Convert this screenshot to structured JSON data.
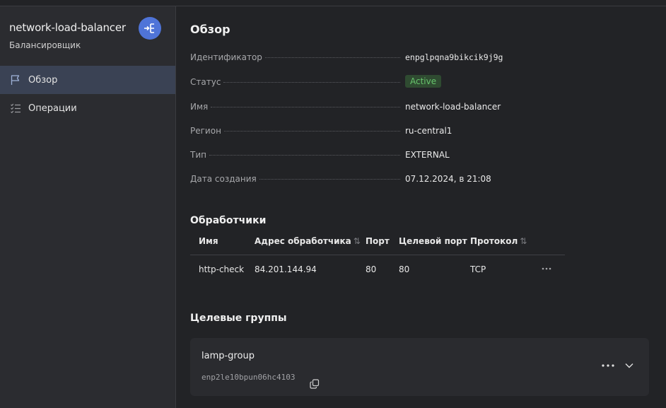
{
  "sidebar": {
    "title": "network-load-balancer",
    "subtitle": "Балансировщик",
    "service_icon": "load-balancer-icon",
    "items": [
      {
        "label": "Обзор",
        "icon": "flag-icon",
        "active": true
      },
      {
        "label": "Операции",
        "icon": "list-icon",
        "active": false
      }
    ]
  },
  "main": {
    "title": "Обзор",
    "properties": [
      {
        "label": "Идентификатор",
        "value": "enpglpqna9bikcik9j9g"
      },
      {
        "label": "Статус",
        "value": "Active"
      },
      {
        "label": "Имя",
        "value": "network-load-balancer"
      },
      {
        "label": "Регион",
        "value": "ru-central1"
      },
      {
        "label": "Тип",
        "value": "EXTERNAL"
      },
      {
        "label": "Дата создания",
        "value": "07.12.2024, в 21:08"
      }
    ],
    "status_colors": {
      "bg": "#2f4b31",
      "text": "#67c46c"
    },
    "listeners": {
      "title": "Обработчики",
      "columns": [
        "Имя",
        "Адрес обработчика",
        "Порт",
        "Целевой порт",
        "Протокол"
      ],
      "sort_icon": "sort-icon",
      "rows": [
        {
          "name": "http-check",
          "address": "84.201.144.94",
          "port": "80",
          "target_port": "80",
          "protocol": "TCP"
        }
      ]
    },
    "target_groups": {
      "title": "Целевые группы",
      "items": [
        {
          "name": "lamp-group",
          "id": "enp2le10bpun06hc4103"
        }
      ]
    }
  },
  "colors": {
    "accent": "#4f74d8",
    "active_nav": "#3a4254",
    "background": "#222326"
  }
}
